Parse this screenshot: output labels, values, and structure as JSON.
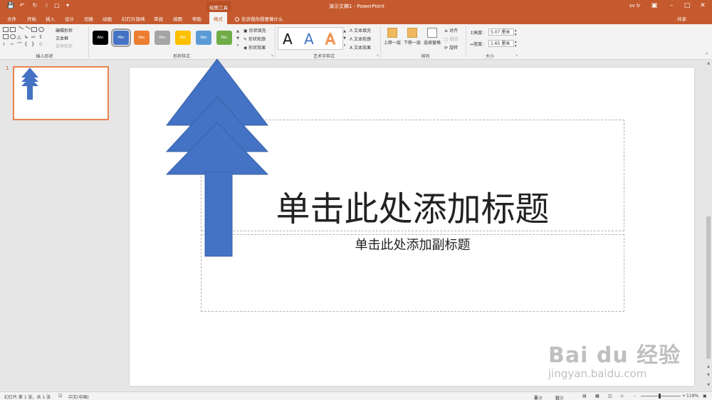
{
  "titlebar": {
    "doc_title": "演示文稿1 - PowerPoint",
    "context_tool": "绘图工具",
    "user": "sv tr",
    "icons": [
      "save-icon",
      "undo-icon",
      "redo-icon",
      "touch-mode-icon",
      "new-file-icon",
      "customize-qat-icon"
    ]
  },
  "tabs": [
    "文件",
    "开始",
    "插入",
    "设计",
    "切换",
    "动画",
    "幻灯片放映",
    "审阅",
    "视图",
    "帮助",
    "格式"
  ],
  "active_tab": "格式",
  "tell_me": "告诉我你想要做什么",
  "share": "共享",
  "ribbon": {
    "insert_shapes": {
      "label": "插入形状",
      "edit_shape": "编辑形状",
      "text_box": "文本框",
      "merge_shapes": "合并形状"
    },
    "shape_styles": {
      "label": "形状样式",
      "swatches": [
        {
          "text": "Abc",
          "color": "#000000"
        },
        {
          "text": "Abc",
          "color": "#4472c4"
        },
        {
          "text": "Abc",
          "color": "#ed7d31"
        },
        {
          "text": "Abc",
          "color": "#a5a5a5"
        },
        {
          "text": "Abc",
          "color": "#ffc000"
        },
        {
          "text": "Abc",
          "color": "#5b9bd5"
        },
        {
          "text": "Abc",
          "color": "#70ad47"
        }
      ],
      "fill": "形状填充",
      "outline": "形状轮廓",
      "effects": "形状效果"
    },
    "wordart": {
      "label": "艺术字样式",
      "letters": [
        "A",
        "A",
        "A"
      ],
      "text_fill": "文本填充",
      "text_outline": "文本轮廓",
      "text_effects": "文本效果"
    },
    "arrange": {
      "label": "排列",
      "bring_forward": "上移一层",
      "send_backward": "下移一层",
      "selection_pane": "选择窗格",
      "align": "对齐",
      "group": "组合",
      "rotate": "旋转"
    },
    "size": {
      "label": "大小",
      "height_label": "高度:",
      "height_value": "5.07 厘米",
      "width_label": "宽度:",
      "width_value": "1.65 厘米"
    }
  },
  "thumbnails": [
    {
      "number": "1"
    }
  ],
  "slide": {
    "title": "单击此处添加标题",
    "subtitle": "单击此处添加副标题",
    "tree_color": "#4472c4"
  },
  "watermark": {
    "brand": "Bai du 经验",
    "url": "jingyan.baidu.com"
  },
  "status": {
    "slide_info": "幻灯片 第 1 张，共 1 张",
    "language": "中文(中国)",
    "notes": "备注",
    "comments": "批注",
    "zoom": "119%"
  },
  "colors": {
    "accent": "#c55a2e",
    "ribbon_bg": "#f3f3f3",
    "thumb_border": "#e8834f"
  }
}
